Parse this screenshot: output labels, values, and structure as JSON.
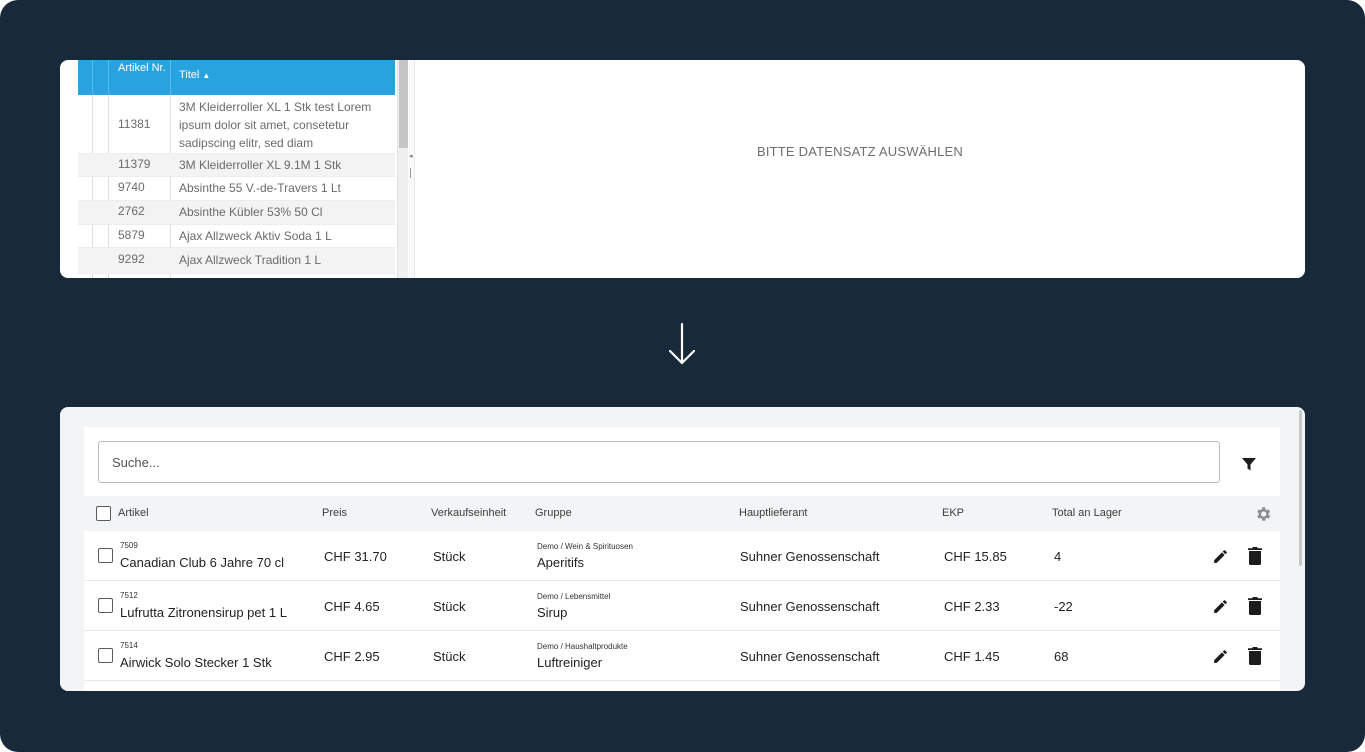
{
  "old_view": {
    "columns": {
      "nr": "Artikel Nr.",
      "title": "Titel"
    },
    "rows": [
      {
        "nr": "11381",
        "title": "3M Kleiderroller XL 1 Stk test Lorem ipsum dolor sit amet, consetetur sadipscing elitr, sed diam"
      },
      {
        "nr": "11379",
        "title": "3M Kleiderroller XL 9.1M 1 Stk"
      },
      {
        "nr": "9740",
        "title": "Absinthe 55 V.-de-Travers 1 Lt"
      },
      {
        "nr": "2762",
        "title": "Absinthe Kübler 53% 50 Cl"
      },
      {
        "nr": "5879",
        "title": "Ajax Allzweck Aktiv Soda 1 L"
      },
      {
        "nr": "9292",
        "title": "Ajax Allzweck Tradition 1 L"
      }
    ],
    "empty_message": "BITTE DATENSATZ AUSWÄHLEN",
    "header_color": "#29a3e0"
  },
  "new_view": {
    "search": {
      "placeholder": "Suche..."
    },
    "columns": {
      "artikel": "Artikel",
      "preis": "Preis",
      "verkaufseinheit": "Verkaufseinheit",
      "gruppe": "Gruppe",
      "hauptlieferant": "Hauptlieferant",
      "ekp": "EKP",
      "lager": "Total an Lager"
    },
    "rows": [
      {
        "nr": "7509",
        "name": "Canadian Club 6 Jahre 70 cl",
        "preis": "CHF 31.70",
        "einheit": "Stück",
        "gruppe_path": "Demo / Wein & Spirituosen",
        "gruppe": "Aperitifs",
        "lieferant": "Suhner Genossenschaft",
        "ekp": "CHF 15.85",
        "lager": "4"
      },
      {
        "nr": "7512",
        "name": "Lufrutta Zitronensirup pet 1 L",
        "preis": "CHF 4.65",
        "einheit": "Stück",
        "gruppe_path": "Demo / Lebensmittel",
        "gruppe": "Sirup",
        "lieferant": "Suhner Genossenschaft",
        "ekp": "CHF 2.33",
        "lager": "-22"
      },
      {
        "nr": "7514",
        "name": "Airwick Solo Stecker 1 Stk",
        "preis": "CHF 2.95",
        "einheit": "Stück",
        "gruppe_path": "Demo / Haushaltprodukte",
        "gruppe": "Luftreiniger",
        "lieferant": "Suhner Genossenschaft",
        "ekp": "CHF 1.45",
        "lager": "68"
      }
    ],
    "icons": [
      "filter-icon",
      "gear-icon",
      "edit-icon",
      "delete-icon"
    ]
  },
  "background_color": "#18293a"
}
